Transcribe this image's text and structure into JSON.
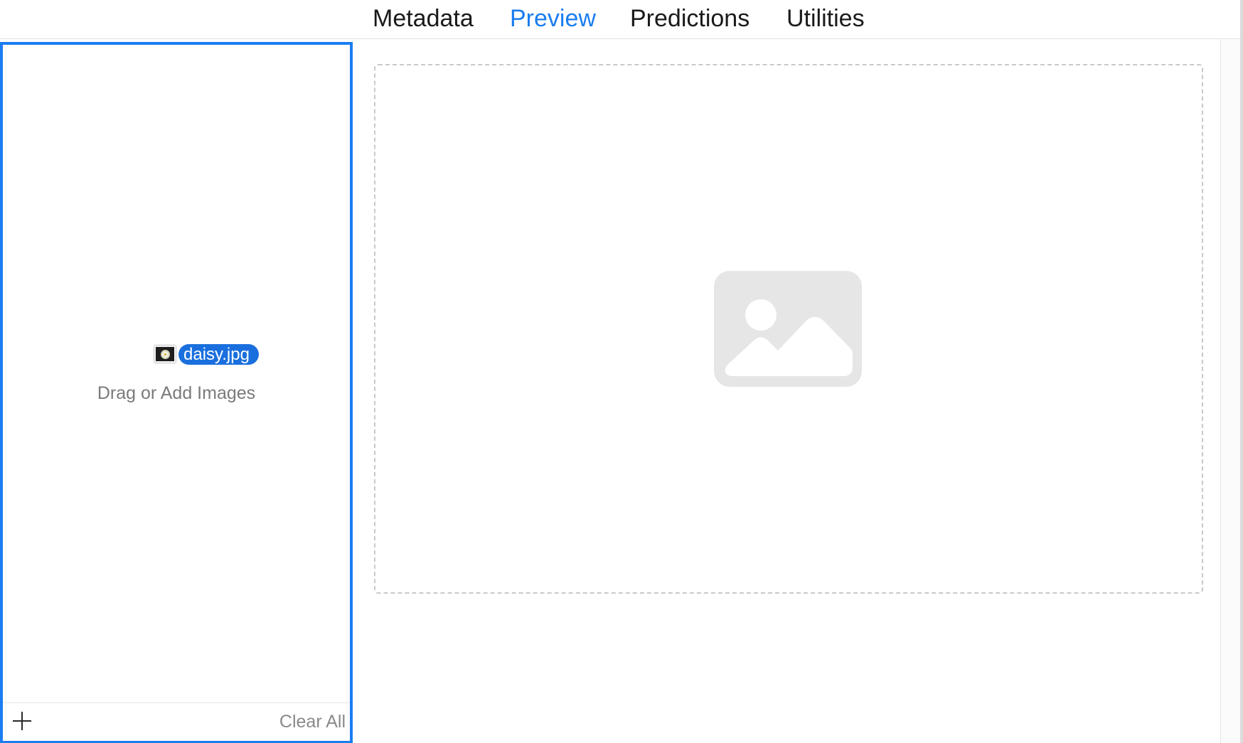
{
  "tabs": {
    "metadata": "Metadata",
    "preview": "Preview",
    "predictions": "Predictions",
    "utilities": "Utilities",
    "active": "Preview"
  },
  "image_list": {
    "dragged_file": "daisy.jpg",
    "empty_hint": "Drag or Add Images",
    "add_icon": "plus-icon",
    "clear_all_label": "Clear All"
  },
  "preview": {
    "placeholder_icon": "image-placeholder-icon"
  },
  "colors": {
    "accent": "#1a7df0",
    "drag_badge": "#1a6fde",
    "placeholder": "#e6e6e6",
    "hint_text": "#7a7a7a"
  }
}
